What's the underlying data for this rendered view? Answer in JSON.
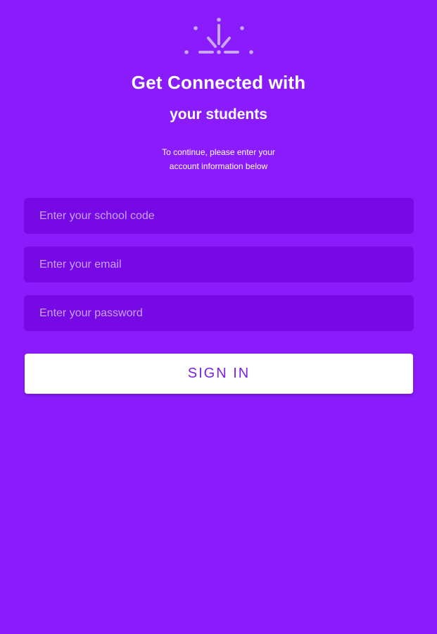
{
  "colors": {
    "background": "#8a1cfb",
    "input_background": "#7609e4",
    "placeholder": "#c7a2f5",
    "button_background": "#ffffff",
    "button_text": "#7a22e6"
  },
  "header": {
    "logo_icon": "sunburst-icon",
    "title_line1": "Get Connected with",
    "title_line2": "your students",
    "subtitle_line1": "To continue, please enter your",
    "subtitle_line2": "account information below"
  },
  "form": {
    "school_code": {
      "value": "",
      "placeholder": "Enter your school code"
    },
    "email": {
      "value": "",
      "placeholder": "Enter your email"
    },
    "password": {
      "value": "",
      "placeholder": "Enter your password"
    },
    "sign_in_label": "SIGN IN"
  }
}
